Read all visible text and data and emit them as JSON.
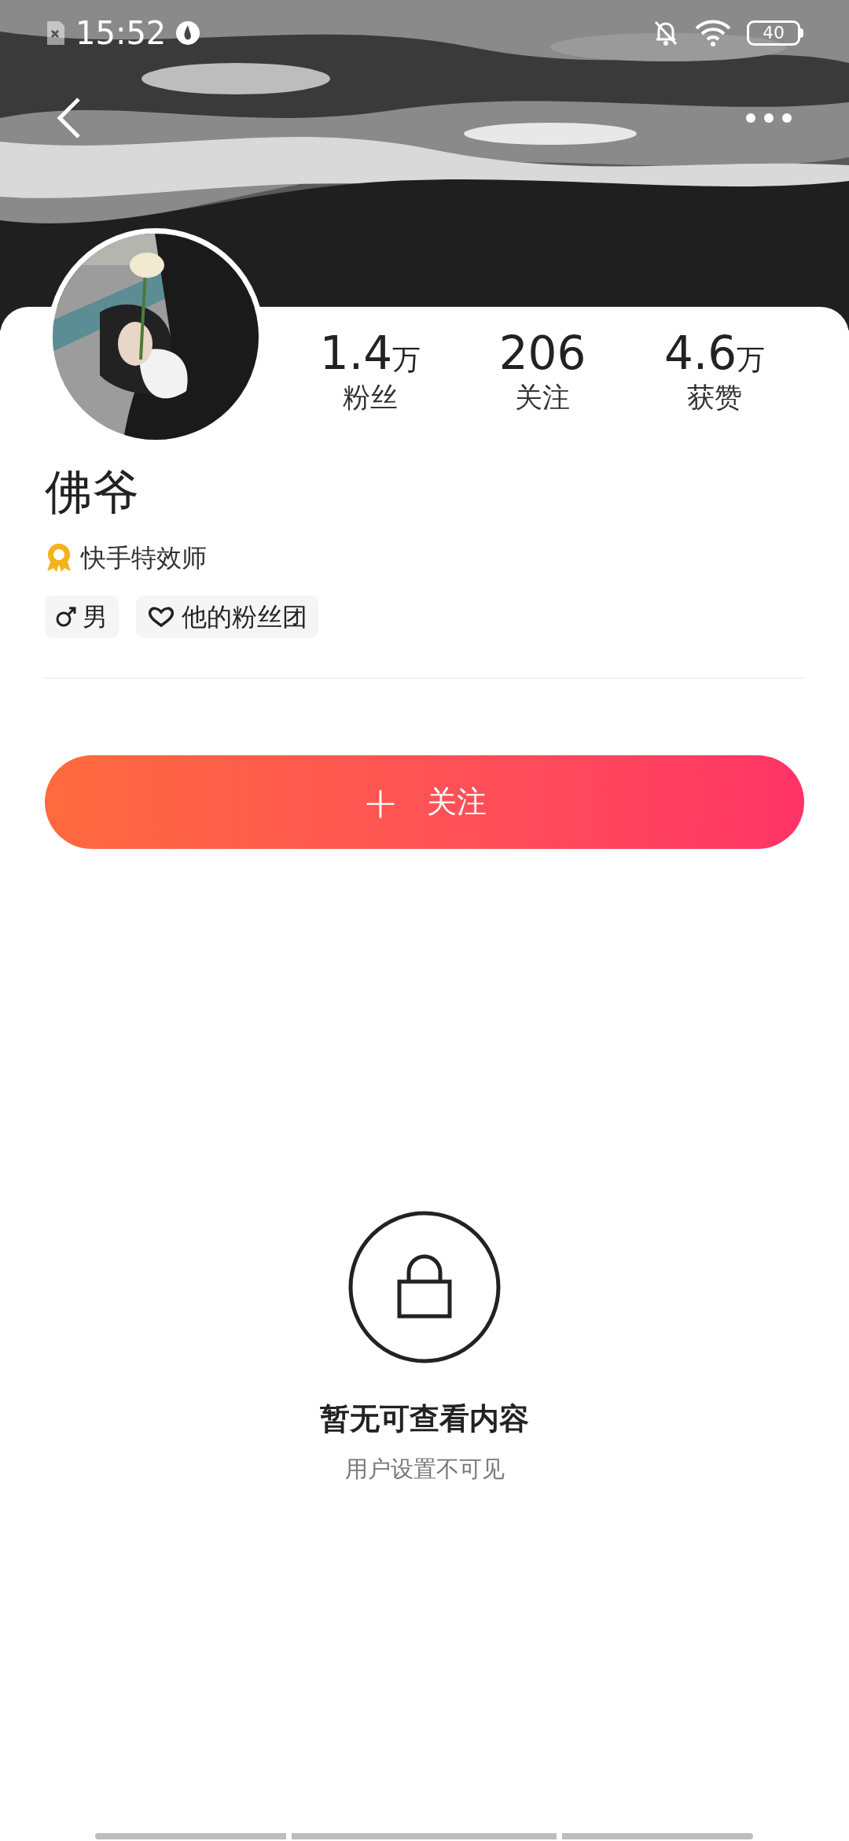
{
  "status_bar": {
    "time": "15:52",
    "battery": "40"
  },
  "profile": {
    "name": "佛爷",
    "title": "快手特效师",
    "stats": [
      {
        "value": "1.4",
        "unit": "万",
        "label": "粉丝"
      },
      {
        "value": "206",
        "label": "关注"
      },
      {
        "value": "4.6",
        "unit": "万",
        "label": "获赞"
      }
    ],
    "tags": [
      {
        "kind": "gender",
        "label": "男"
      },
      {
        "kind": "fan_club",
        "label": "他的粉丝团"
      }
    ]
  },
  "follow_button": {
    "icon": "+",
    "label": "关注"
  },
  "empty_state": {
    "title": "暂无可查看内容",
    "subtitle": "用户设置不可见"
  }
}
